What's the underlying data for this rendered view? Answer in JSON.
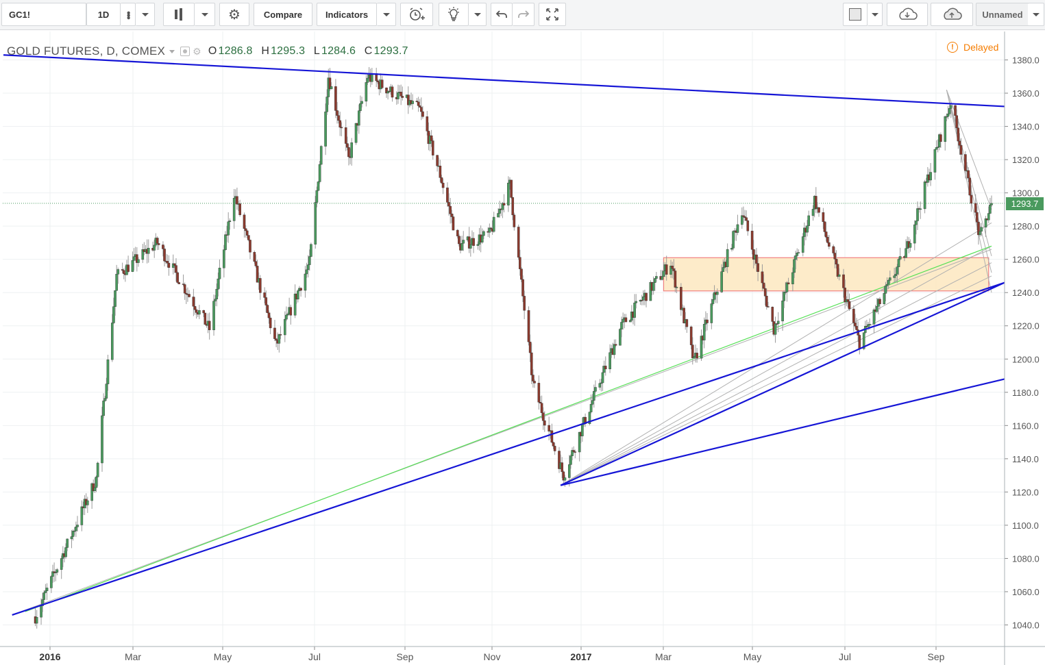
{
  "toolbar": {
    "symbol": "GC1!",
    "interval": "1D",
    "compare_label": "Compare",
    "indicators_label": "Indicators",
    "layout_name": "Unnamed",
    "icons": {
      "more": "more-vertical-icon",
      "chart_style": "candlestick-icon",
      "settings": "gear-icon",
      "alert": "alarm-clock-plus-icon",
      "ideas": "lightbulb-icon",
      "undo": "undo-arrow-icon",
      "redo": "redo-arrow-icon",
      "fullscreen": "fullscreen-arrows-icon",
      "square": "square-icon",
      "load": "cloud-download-icon",
      "save": "cloud-upload-icon"
    }
  },
  "legend": {
    "title": "GOLD FUTURES, D, COMEX",
    "open_label": "O",
    "open": "1286.8",
    "high_label": "H",
    "high": "1295.3",
    "low_label": "L",
    "low": "1284.6",
    "close_label": "C",
    "close": "1293.7"
  },
  "status": {
    "delayed": "Delayed"
  },
  "price_axis": {
    "ticks": [
      "1380.0",
      "1360.0",
      "1340.0",
      "1320.0",
      "1300.0",
      "1280.0",
      "1260.0",
      "1240.0",
      "1220.0",
      "1200.0",
      "1180.0",
      "1160.0",
      "1140.0",
      "1120.0",
      "1100.0",
      "1080.0",
      "1060.0",
      "1040.0"
    ],
    "last_price": "1293.7"
  },
  "time_axis": {
    "ticks": [
      {
        "label": "2016",
        "bold": true
      },
      {
        "label": "Mar",
        "bold": false
      },
      {
        "label": "May",
        "bold": false
      },
      {
        "label": "Jul",
        "bold": false
      },
      {
        "label": "Sep",
        "bold": false
      },
      {
        "label": "Nov",
        "bold": false
      },
      {
        "label": "2017",
        "bold": true
      },
      {
        "label": "Mar",
        "bold": false
      },
      {
        "label": "May",
        "bold": false
      },
      {
        "label": "Jul",
        "bold": false
      },
      {
        "label": "Sep",
        "bold": false
      }
    ]
  },
  "colors": {
    "up": "#4a9a5e",
    "down": "#8b3a2e",
    "trendline": "#1515d6",
    "green_line": "#55e055",
    "zone_fill": "#fde8c0",
    "zone_border": "#f08080",
    "warning": "#f57c00"
  },
  "chart_data": {
    "type": "candlestick",
    "symbol": "GC1!",
    "exchange": "COMEX",
    "interval": "D",
    "ylim": [
      1030,
      1388
    ],
    "key_points": [
      {
        "date": "2015-12-17",
        "price": 1045
      },
      {
        "date": "2016-01-28",
        "price": 1128
      },
      {
        "date": "2016-02-11",
        "price": 1250
      },
      {
        "date": "2016-03-10",
        "price": 1270
      },
      {
        "date": "2016-04-15",
        "price": 1218
      },
      {
        "date": "2016-05-02",
        "price": 1300
      },
      {
        "date": "2016-05-31",
        "price": 1208
      },
      {
        "date": "2016-06-23",
        "price": 1258
      },
      {
        "date": "2016-07-06",
        "price": 1370
      },
      {
        "date": "2016-07-20",
        "price": 1320
      },
      {
        "date": "2016-08-02",
        "price": 1370
      },
      {
        "date": "2016-09-07",
        "price": 1350
      },
      {
        "date": "2016-09-20",
        "price": 1314
      },
      {
        "date": "2016-10-04",
        "price": 1268
      },
      {
        "date": "2016-10-25",
        "price": 1275
      },
      {
        "date": "2016-11-08",
        "price": 1305
      },
      {
        "date": "2016-11-24",
        "price": 1185
      },
      {
        "date": "2016-12-15",
        "price": 1130
      },
      {
        "date": "2017-01-24",
        "price": 1220
      },
      {
        "date": "2017-02-27",
        "price": 1258
      },
      {
        "date": "2017-03-15",
        "price": 1198
      },
      {
        "date": "2017-04-17",
        "price": 1290
      },
      {
        "date": "2017-05-09",
        "price": 1218
      },
      {
        "date": "2017-06-06",
        "price": 1296
      },
      {
        "date": "2017-07-07",
        "price": 1210
      },
      {
        "date": "2017-08-08",
        "price": 1265
      },
      {
        "date": "2017-09-08",
        "price": 1355
      },
      {
        "date": "2017-09-28",
        "price": 1273
      },
      {
        "date": "2017-10-06",
        "price": 1293.7
      }
    ],
    "zone": {
      "from": "2017-02-22",
      "to": "2017-10-04",
      "low": 1241,
      "high": 1261
    },
    "trendlines": [
      {
        "kind": "resistance",
        "from": {
          "date": "2015-11-25",
          "price": 1383
        },
        "to": {
          "date": "2017-10-06",
          "price": 1352
        }
      },
      {
        "kind": "support",
        "from": {
          "date": "2015-12-01",
          "price": 1046
        },
        "to": {
          "date": "2017-10-06",
          "price": 1246
        }
      },
      {
        "kind": "support",
        "from": {
          "date": "2016-12-13",
          "price": 1124
        },
        "to": {
          "date": "2017-10-06",
          "price": 1188
        }
      },
      {
        "kind": "support",
        "from": {
          "date": "2016-12-13",
          "price": 1124
        },
        "to": {
          "date": "2017-10-06",
          "price": 1246
        }
      }
    ]
  }
}
